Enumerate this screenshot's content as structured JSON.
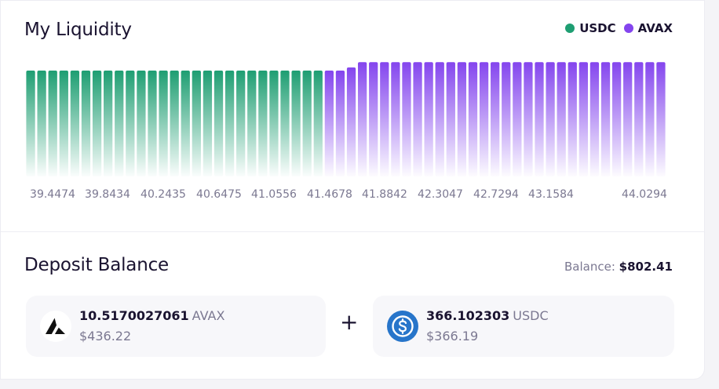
{
  "liquidity": {
    "title": "My Liquidity",
    "legend": [
      {
        "label": "USDC",
        "color": "#1e9e72"
      },
      {
        "label": "AVAX",
        "color": "#8445ee"
      }
    ]
  },
  "chart_data": {
    "type": "bar",
    "title": "My Liquidity",
    "x_tick_labels": [
      "39.4474",
      "39.8434",
      "40.2435",
      "40.6475",
      "41.0556",
      "41.4678",
      "41.8842",
      "42.3047",
      "42.7294",
      "43.1584",
      "44.0294"
    ],
    "series": [
      {
        "name": "USDC",
        "color": "#1e9e72",
        "values": [
          1,
          1,
          1,
          1,
          1,
          1,
          1,
          1,
          1,
          1,
          1,
          1,
          1,
          1,
          1,
          1,
          1,
          1,
          1,
          1,
          1,
          1,
          1,
          1,
          1,
          1,
          1
        ]
      },
      {
        "name": "AVAX",
        "color": "#8445ee",
        "values": [
          1,
          1,
          1.03,
          1.08,
          1.08,
          1.08,
          1.08,
          1.08,
          1.08,
          1.08,
          1.08,
          1.08,
          1.08,
          1.08,
          1.08,
          1.08,
          1.08,
          1.08,
          1.08,
          1.08,
          1.08,
          1.08,
          1.08,
          1.08,
          1.08,
          1.08,
          1.08,
          1.08,
          1.08,
          1.08,
          1.08
        ]
      }
    ],
    "grid": false,
    "legend_position": "top-right"
  },
  "deposit": {
    "title": "Deposit Balance",
    "balance_label": "Balance:",
    "balance_value": "$802.41",
    "plus": "+",
    "avax": {
      "amount": "10.5170027061",
      "symbol": "AVAX",
      "usd": "$436.22",
      "icon": "avax-logo-icon"
    },
    "usdc": {
      "amount": "366.102303",
      "symbol": "USDC",
      "usd": "$366.19",
      "icon": "usdc-logo-icon"
    }
  }
}
